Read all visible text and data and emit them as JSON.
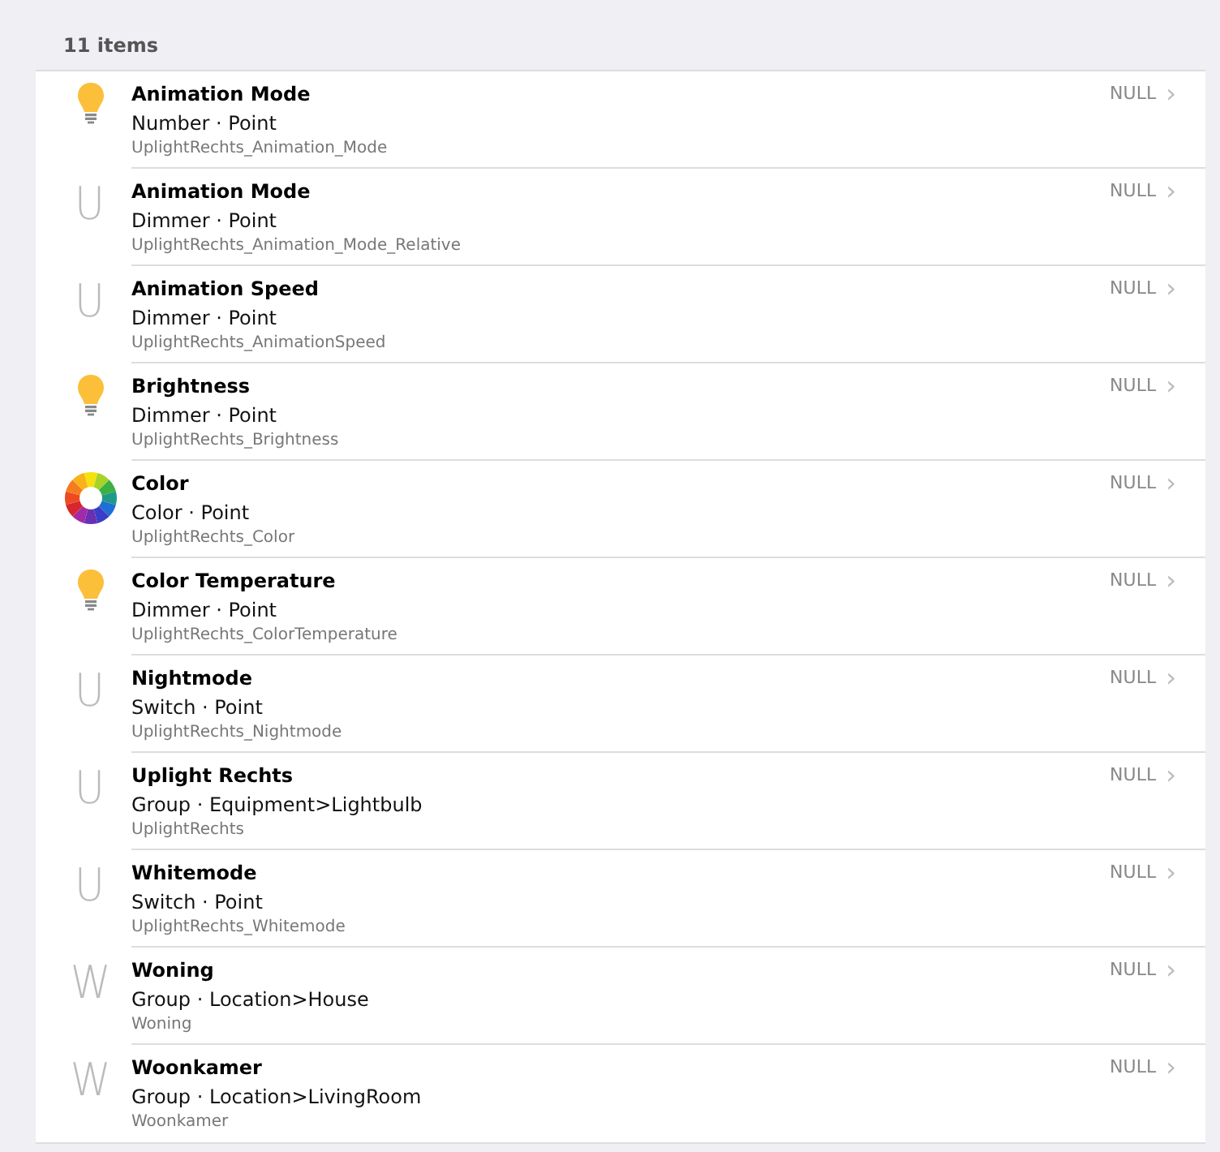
{
  "header": {
    "count": "11 items"
  },
  "items": [
    {
      "icon": {
        "kind": "bulb"
      },
      "label": "Animation Mode",
      "type": "Number · Point",
      "name": "UplightRechts_Animation_Mode",
      "state": "NULL",
      "chevron": "›"
    },
    {
      "icon": {
        "kind": "letter",
        "letter": "U"
      },
      "label": "Animation Mode",
      "type": "Dimmer · Point",
      "name": "UplightRechts_Animation_Mode_Relative",
      "state": "NULL",
      "chevron": "›"
    },
    {
      "icon": {
        "kind": "letter",
        "letter": "U"
      },
      "label": "Animation Speed",
      "type": "Dimmer · Point",
      "name": "UplightRechts_AnimationSpeed",
      "state": "NULL",
      "chevron": "›"
    },
    {
      "icon": {
        "kind": "bulb"
      },
      "label": "Brightness",
      "type": "Dimmer · Point",
      "name": "UplightRechts_Brightness",
      "state": "NULL",
      "chevron": "›"
    },
    {
      "icon": {
        "kind": "colorwheel"
      },
      "label": "Color",
      "type": "Color · Point",
      "name": "UplightRechts_Color",
      "state": "NULL",
      "chevron": "›"
    },
    {
      "icon": {
        "kind": "bulb"
      },
      "label": "Color Temperature",
      "type": "Dimmer · Point",
      "name": "UplightRechts_ColorTemperature",
      "state": "NULL",
      "chevron": "›"
    },
    {
      "icon": {
        "kind": "letter",
        "letter": "U"
      },
      "label": "Nightmode",
      "type": "Switch · Point",
      "name": "UplightRechts_Nightmode",
      "state": "NULL",
      "chevron": "›"
    },
    {
      "icon": {
        "kind": "letter",
        "letter": "U"
      },
      "label": "Uplight Rechts",
      "type": "Group · Equipment>Lightbulb",
      "name": "UplightRechts",
      "state": "NULL",
      "chevron": "›"
    },
    {
      "icon": {
        "kind": "letter",
        "letter": "U"
      },
      "label": "Whitemode",
      "type": "Switch · Point",
      "name": "UplightRechts_Whitemode",
      "state": "NULL",
      "chevron": "›"
    },
    {
      "icon": {
        "kind": "letter",
        "letter": "W"
      },
      "label": "Woning",
      "type": "Group · Location>House",
      "name": "Woning",
      "state": "NULL",
      "chevron": "›"
    },
    {
      "icon": {
        "kind": "letter",
        "letter": "W"
      },
      "label": "Woonkamer",
      "type": "Group · Location>LivingRoom",
      "name": "Woonkamer",
      "state": "NULL",
      "chevron": "›"
    }
  ]
}
